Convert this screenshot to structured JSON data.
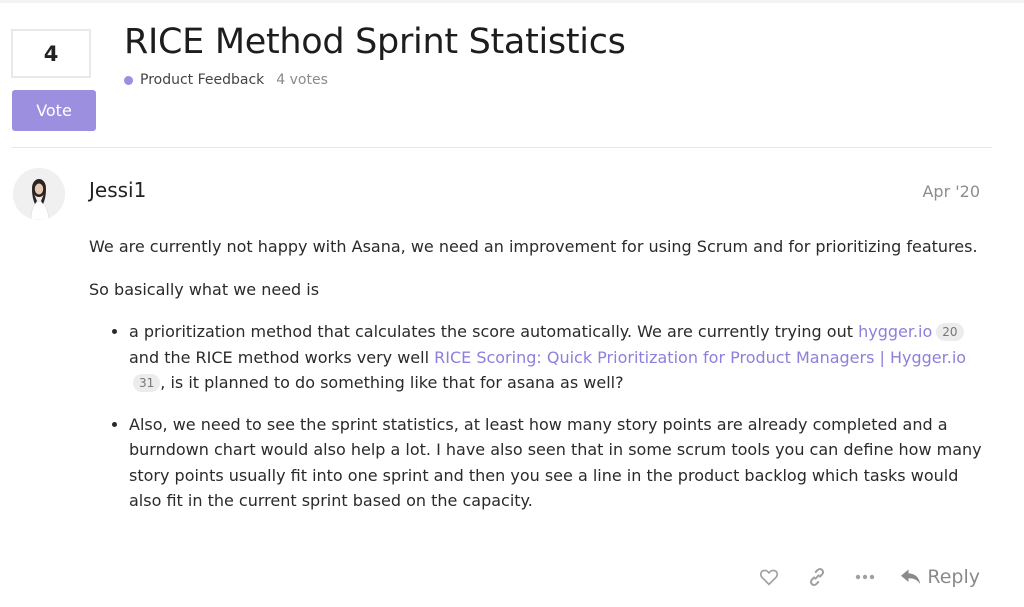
{
  "topic": {
    "title": "RICE Method Sprint Statistics",
    "category": "Product Feedback",
    "votes_text": "4 votes",
    "vote_count": "4",
    "vote_button_label": "Vote"
  },
  "post": {
    "username": "Jessi1",
    "date": "Apr '20",
    "paragraphs": [
      "We are currently not happy with Asana, we need an improvement for using Scrum and for prioritizing features.",
      "So basically what we need is"
    ],
    "bullet1": {
      "text_a": "a prioritization method that calculates the score automatically. We are currently trying out ",
      "link1": "hygger.io",
      "link1_clicks": "20",
      "text_b": " and the RICE method works very well ",
      "link2": "RICE Scoring: Quick Prioritization for Product Managers | Hygger.io",
      "link2_clicks": "31",
      "text_c": ", is it planned to do something like that for asana as well?"
    },
    "bullet2": "Also, we need to see the sprint statistics, at least how many story points are already completed and a burndown chart would also help a lot. I have also seen that in some scrum tools you can define how many story points usually fit into one sprint and then you see a line in the product backlog which tasks would also fit in the current sprint based on the capacity."
  },
  "actions": {
    "like_icon": "heart-icon",
    "link_icon": "link-icon",
    "more_icon": "ellipsis-icon",
    "reply_label": "Reply"
  },
  "colors": {
    "accent": "#9d8fe0",
    "link": "#8c80dc",
    "muted": "#8d8d8d"
  }
}
